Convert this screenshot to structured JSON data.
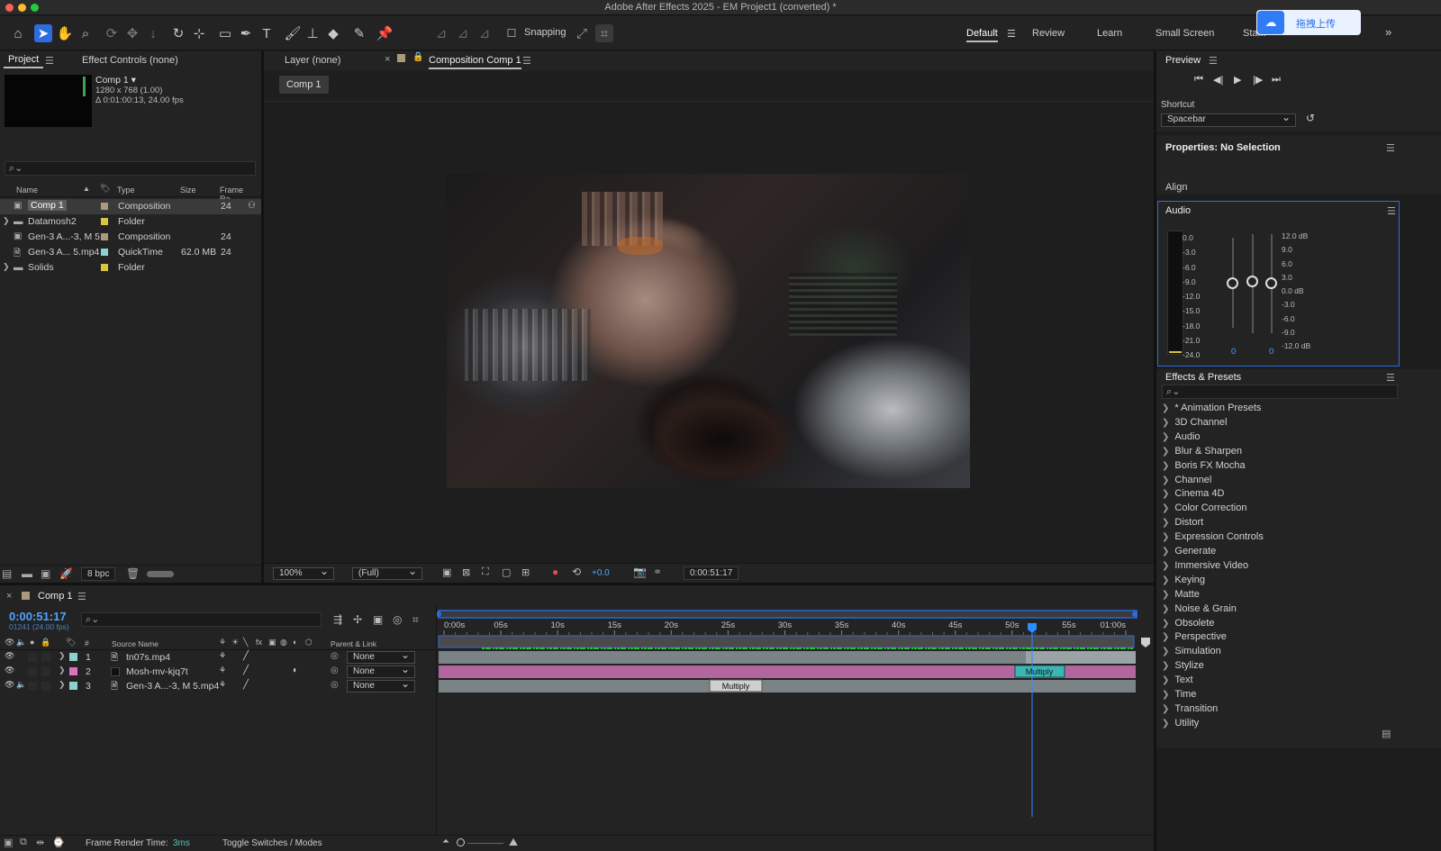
{
  "window": {
    "title": "Adobe After Effects 2025 - EM Project1 (converted) *"
  },
  "toolbar": {
    "snapping_label": "Snapping",
    "workspaces": [
      "Default",
      "Review",
      "Learn",
      "Small Screen",
      "Sta..."
    ],
    "upload_button": "拖拽上传"
  },
  "project_panel": {
    "tabs": [
      "Project",
      "Effect Controls (none)"
    ],
    "selected_item": {
      "name": "Comp 1 ▾",
      "dims": "1280 x 768 (1.00)",
      "duration": "Δ 0:01:00:13, 24.00 fps"
    },
    "columns": [
      "Name",
      "Type",
      "Size",
      "Frame Ra..."
    ],
    "items": [
      {
        "name": "Comp 1",
        "type": "Composition",
        "size": "",
        "fps": "24",
        "color": "#a89a7a"
      },
      {
        "name": "Datamosh2",
        "type": "Folder",
        "size": "",
        "fps": "",
        "color": "#d8c640"
      },
      {
        "name": "Gen-3 A...-3, M 5",
        "type": "Composition",
        "size": "",
        "fps": "24",
        "color": "#a89a7a"
      },
      {
        "name": "Gen-3 A... 5.mp4",
        "type": "QuickTime",
        "size": "62.0 MB",
        "fps": "24",
        "color": "#8fcfcf"
      },
      {
        "name": "Solids",
        "type": "Folder",
        "size": "",
        "fps": "",
        "color": "#d8c640"
      }
    ],
    "footer_bpc": "8 bpc"
  },
  "comp_panel": {
    "tabs": [
      "Layer (none)",
      "Composition Comp 1"
    ],
    "breadcrumb": "Comp 1",
    "zoom": "100%",
    "resolution": "(Full)",
    "exposure": "+0.0",
    "timecode": "0:00:51:17"
  },
  "preview_panel": {
    "title": "Preview",
    "shortcut_label": "Shortcut",
    "shortcut_value": "Spacebar"
  },
  "properties_panel": {
    "title": "Properties: No Selection",
    "align_label": "Align"
  },
  "audio_panel": {
    "title": "Audio",
    "left_scale": [
      "0.0",
      "-3.0",
      "-6.0",
      "-9.0",
      "-12.0",
      "-15.0",
      "-18.0",
      "-21.0",
      "-24.0"
    ],
    "right_scale": [
      "12.0 dB",
      "9.0",
      "6.0",
      "3.0",
      "0.0 dB",
      "-3.0",
      "-6.0",
      "-9.0",
      "-12.0 dB"
    ],
    "left_value": "0",
    "right_value": "0"
  },
  "effects_panel": {
    "title": "Effects & Presets",
    "items": [
      "* Animation Presets",
      "3D Channel",
      "Audio",
      "Blur & Sharpen",
      "Boris FX Mocha",
      "Channel",
      "Cinema 4D",
      "Color Correction",
      "Distort",
      "Expression Controls",
      "Generate",
      "Immersive Video",
      "Keying",
      "Matte",
      "Noise & Grain",
      "Obsolete",
      "Perspective",
      "Simulation",
      "Stylize",
      "Text",
      "Time",
      "Transition",
      "Utility"
    ]
  },
  "timeline": {
    "tab": "Comp 1",
    "timecode": "0:00:51:17",
    "frame_info": "01241 (24.00 fps)",
    "column_source": "Source Name",
    "column_parent": "Parent & Link",
    "ruler": [
      "0:00s",
      "05s",
      "10s",
      "15s",
      "20s",
      "25s",
      "30s",
      "35s",
      "40s",
      "45s",
      "50s",
      "55s",
      "01:00s"
    ],
    "layers": [
      {
        "num": "1",
        "name": "tn07s.mp4",
        "parent": "None",
        "color": "#8fcfcf"
      },
      {
        "num": "2",
        "name": "Mosh-mv-kjq7t",
        "parent": "None",
        "color": "#e070c0"
      },
      {
        "num": "3",
        "name": "Gen-3 A...-3, M 5.mp4",
        "parent": "None",
        "color": "#8fcfcf"
      }
    ],
    "mode_labels": [
      "Multiply",
      "Multiply"
    ],
    "footer_render_label": "Frame Render Time:",
    "footer_render_value": "3ms",
    "footer_toggle": "Toggle Switches / Modes"
  }
}
